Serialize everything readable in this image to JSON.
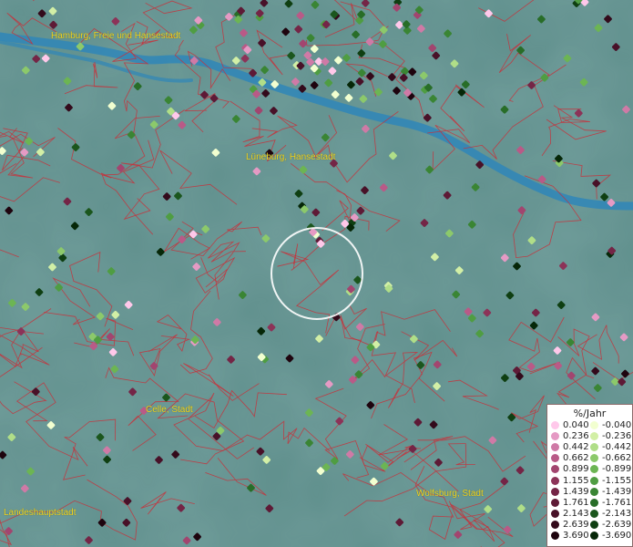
{
  "map": {
    "labels": {
      "hamburg": "Hamburg, Freie und Hansestadt",
      "lueneburg": "Lüneburg, Hansestadt",
      "celle": "Celle, Stadt",
      "wolfsburg": "Wolfsburg, Stadt",
      "landeshauptstadt": "Landeshauptstadt"
    },
    "colors": {
      "background": "#5f8f8c",
      "river": "#2f86b8",
      "boundaries": "#c8303a",
      "label_text": "#f2d51e",
      "focus_circle": "#ffffff"
    }
  },
  "legend": {
    "title": "%/Jahr",
    "positive": [
      {
        "label": "0.040",
        "color": "#ffc8ea"
      },
      {
        "label": "0.236",
        "color": "#e59ac4"
      },
      {
        "label": "0.442",
        "color": "#cf7aa6"
      },
      {
        "label": "0.662",
        "color": "#b95a87"
      },
      {
        "label": "0.899",
        "color": "#a2456f"
      },
      {
        "label": "1.155",
        "color": "#8c3358"
      },
      {
        "label": "1.439",
        "color": "#742546"
      },
      {
        "label": "1.761",
        "color": "#5e1a36"
      },
      {
        "label": "2.143",
        "color": "#481128"
      },
      {
        "label": "2.639",
        "color": "#330a1b"
      },
      {
        "label": "3.690",
        "color": "#1e040e"
      }
    ],
    "negative": [
      {
        "label": "-0.040",
        "color": "#f2ffd0"
      },
      {
        "label": "-0.236",
        "color": "#d2efa6"
      },
      {
        "label": "-0.442",
        "color": "#b0de88"
      },
      {
        "label": "-0.662",
        "color": "#8cc96b"
      },
      {
        "label": "-0.899",
        "color": "#6cb553"
      },
      {
        "label": "-1.155",
        "color": "#4f9d42"
      },
      {
        "label": "-1.439",
        "color": "#3a8534"
      },
      {
        "label": "-1.761",
        "color": "#286d28"
      },
      {
        "label": "-2.143",
        "color": "#1b561d"
      },
      {
        "label": "-2.639",
        "color": "#0f3f12"
      },
      {
        "label": "-3.690",
        "color": "#062708"
      }
    ]
  }
}
